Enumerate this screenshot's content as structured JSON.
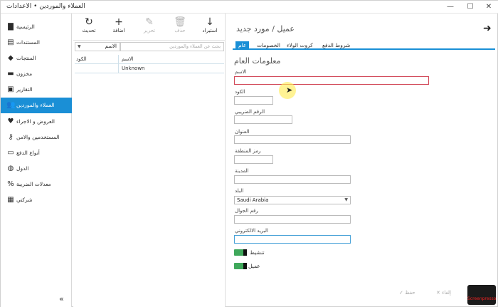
{
  "window": {
    "title": "العملاء والموردين • الاعدادات",
    "minimize": "—",
    "maximize": "☐",
    "close": "✕"
  },
  "sidebar": {
    "items": [
      {
        "label": "الرئيسية",
        "icon": "chart-icon",
        "glyph": "▇"
      },
      {
        "label": "المستندات",
        "icon": "document-icon",
        "glyph": "▤"
      },
      {
        "label": "المنتجات",
        "icon": "tag-icon",
        "glyph": "◆"
      },
      {
        "label": "مخزون",
        "icon": "inventory-icon",
        "glyph": "▬"
      },
      {
        "label": "التقارير",
        "icon": "printer-icon",
        "glyph": "▣"
      },
      {
        "label": "العملاء والموردين",
        "icon": "users-icon",
        "glyph": "👥",
        "active": true
      },
      {
        "label": "العروض و الاجراء",
        "icon": "heart-icon",
        "glyph": "♥"
      },
      {
        "label": "المستخدمين والامن",
        "icon": "key-icon",
        "glyph": "⚷"
      },
      {
        "label": "أنواع الدفع",
        "icon": "credit-card-icon",
        "glyph": "▭"
      },
      {
        "label": "الدول",
        "icon": "globe-icon",
        "glyph": "◍"
      },
      {
        "label": "معدلات الضريبة",
        "icon": "percent-icon",
        "glyph": "%"
      },
      {
        "label": "شركتي",
        "icon": "building-icon",
        "glyph": "▦"
      }
    ],
    "collapse_glyph": "«"
  },
  "toolbar": {
    "refresh": {
      "label": "تحديث",
      "glyph": "↻"
    },
    "add": {
      "label": "اضافة",
      "glyph": "+"
    },
    "edit": {
      "label": "تحرير",
      "glyph": "✎"
    },
    "delete": {
      "label": "حذف",
      "glyph": "🗑"
    },
    "import": {
      "label": "استيراد",
      "glyph": "↓"
    }
  },
  "search": {
    "column_value": "الاسم",
    "placeholder": "بحث عن العملاء والموردين"
  },
  "grid": {
    "headers": [
      "الكود",
      "الاسم"
    ],
    "rows": [
      [
        "",
        "Unknown"
      ]
    ]
  },
  "form": {
    "back_glyph": "➜",
    "title": "عميل / مورد جديد",
    "tabs": [
      "عام",
      "الخصومات",
      "كروت الولاء",
      "شروط الدفع"
    ],
    "section_title": "معلومات العام",
    "fields": {
      "name_label": "الاسم",
      "code_label": "الكود",
      "tax_label": "الرقم الضريبي",
      "address_label": "العنوان",
      "zip_label": "رمز المنطقة",
      "city_label": "المدينة",
      "country_label": "البلد",
      "country_value": "Saudi Arabia",
      "mobile_label": "رقم الجوال",
      "email_label": "البريد الالكتروني"
    },
    "toggles": {
      "active_label": "تنشيط",
      "customer_label": "عميل"
    },
    "bottom": {
      "save_label": "✓ حفظ",
      "cancel_label": "✕ إلغاء"
    }
  },
  "watermark": {
    "text": "Screenpresso"
  }
}
